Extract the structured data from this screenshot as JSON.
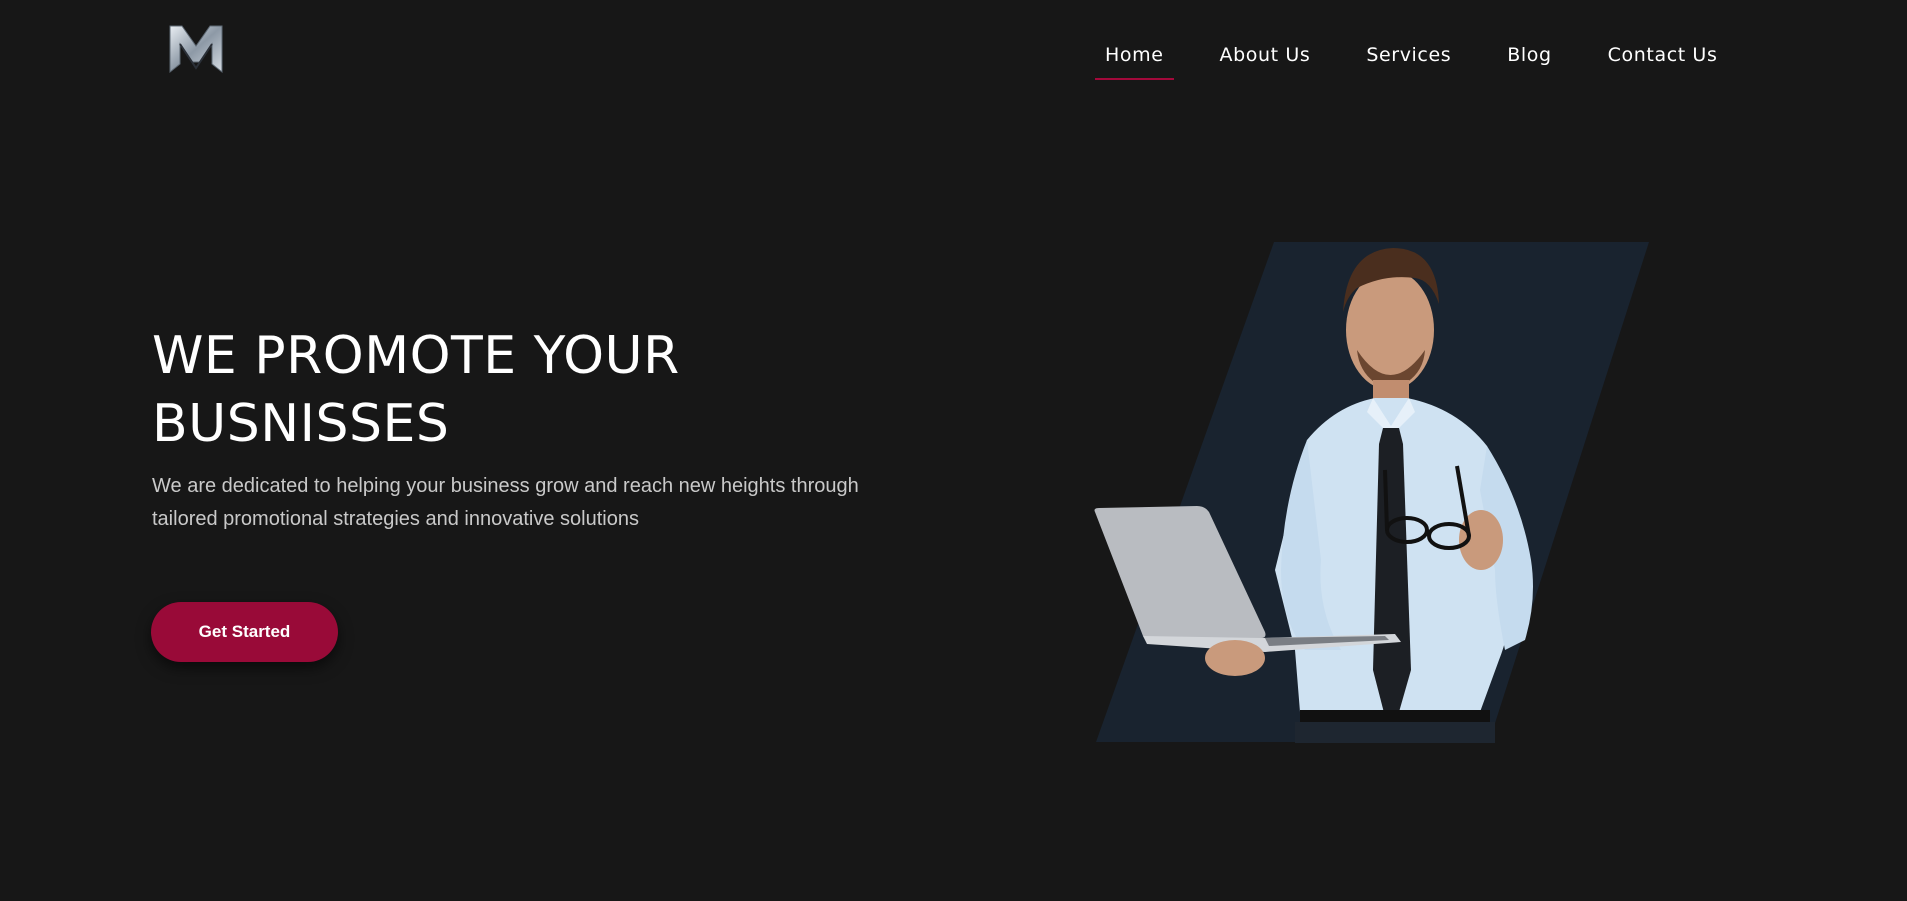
{
  "header": {
    "logo_icon": "monogram-m-logo",
    "nav": [
      {
        "label": "Home",
        "active": true
      },
      {
        "label": "About Us",
        "active": false
      },
      {
        "label": "Services",
        "active": false
      },
      {
        "label": "Blog",
        "active": false
      },
      {
        "label": "Contact Us",
        "active": false
      }
    ]
  },
  "hero": {
    "title_line1": "WE PROMOTE YOUR",
    "title_line2": "BUSNISSES",
    "subtitle_line1": "We are dedicated to helping your business grow and reach new heights through",
    "subtitle_line2": "tailored promotional strategies and innovative solutions",
    "cta_label": "Get Started",
    "image_subject": "businessman-with-laptop-illustration"
  },
  "colors": {
    "background": "#171717",
    "accent": "#990a38",
    "nav_underline": "#a3093b",
    "panel": "#19232f",
    "text_primary": "#ffffff",
    "text_secondary": "#c9c9c9"
  }
}
